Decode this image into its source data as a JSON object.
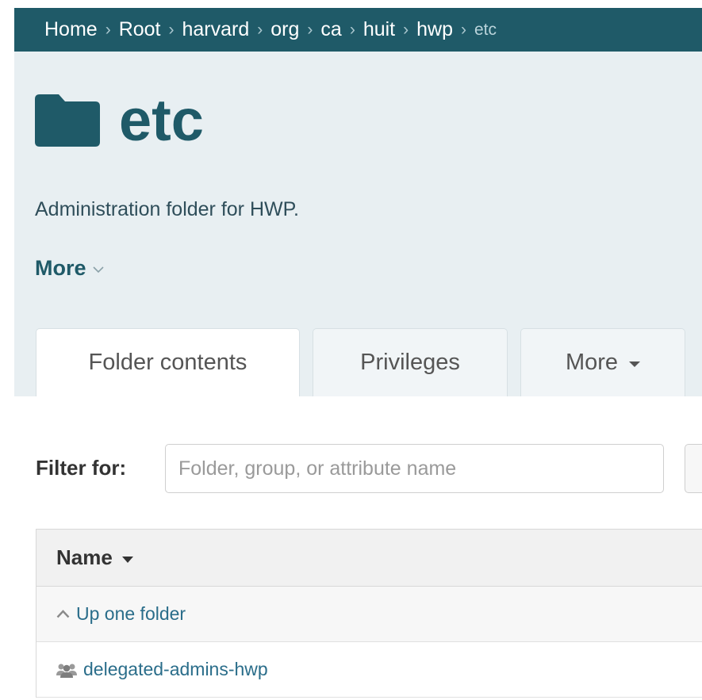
{
  "breadcrumb": {
    "items": [
      "Home",
      "Root",
      "harvard",
      "org",
      "ca",
      "huit",
      "hwp"
    ],
    "current": "etc",
    "separator": "›"
  },
  "header": {
    "title": "etc",
    "description": "Administration folder for HWP.",
    "more_label": "More"
  },
  "tabs": [
    {
      "label": "Folder contents",
      "active": true
    },
    {
      "label": "Privileges",
      "active": false
    },
    {
      "label": "More",
      "active": false
    }
  ],
  "filter": {
    "label": "Filter for:",
    "placeholder": "Folder, group, or attribute name",
    "value": ""
  },
  "table": {
    "columns": [
      "Name"
    ],
    "rows": [
      {
        "label": "Up one folder",
        "icon": "chevron-up-icon"
      },
      {
        "label": "delegated-admins-hwp",
        "icon": "group-icon"
      }
    ]
  },
  "colors": {
    "brand": "#1f5a68",
    "panel": "#e8eff2",
    "link": "#2a6d8a"
  }
}
